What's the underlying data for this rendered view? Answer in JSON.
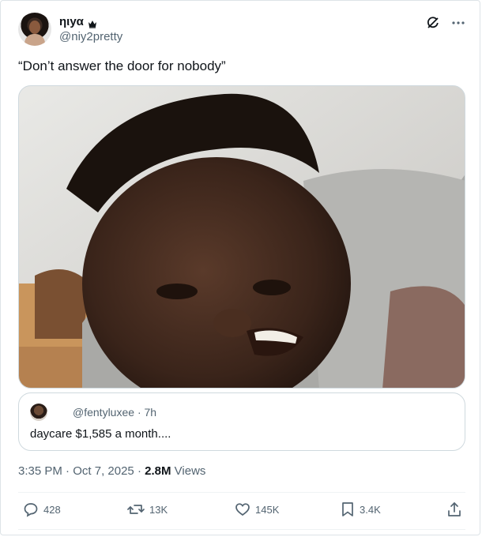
{
  "author": {
    "display_name": "ηιуα",
    "handle": "@niy2pretty"
  },
  "tweet": {
    "text": "“Don’t answer the door for nobody”"
  },
  "quote": {
    "handle": "@fentyluxee",
    "separator": "·",
    "age": "7h",
    "text": "daycare $1,585 a month...."
  },
  "meta": {
    "time": "3:35 PM",
    "sep1": "·",
    "date": "Oct 7, 2025",
    "sep2": "·",
    "views_count": "2.8M",
    "views_label": "Views"
  },
  "actions": {
    "replies": "428",
    "reposts": "13K",
    "likes": "145K",
    "bookmarks": "3.4K"
  },
  "icons": {
    "grok": "grok-icon",
    "more": "more-icon",
    "reply": "reply-icon",
    "repost": "repost-icon",
    "like": "like-icon",
    "bookmark": "bookmark-icon",
    "share": "share-icon",
    "crown": "crown-icon"
  },
  "colors": {
    "text": "#0f1419",
    "secondary": "#536471",
    "border": "#cfd9de"
  }
}
